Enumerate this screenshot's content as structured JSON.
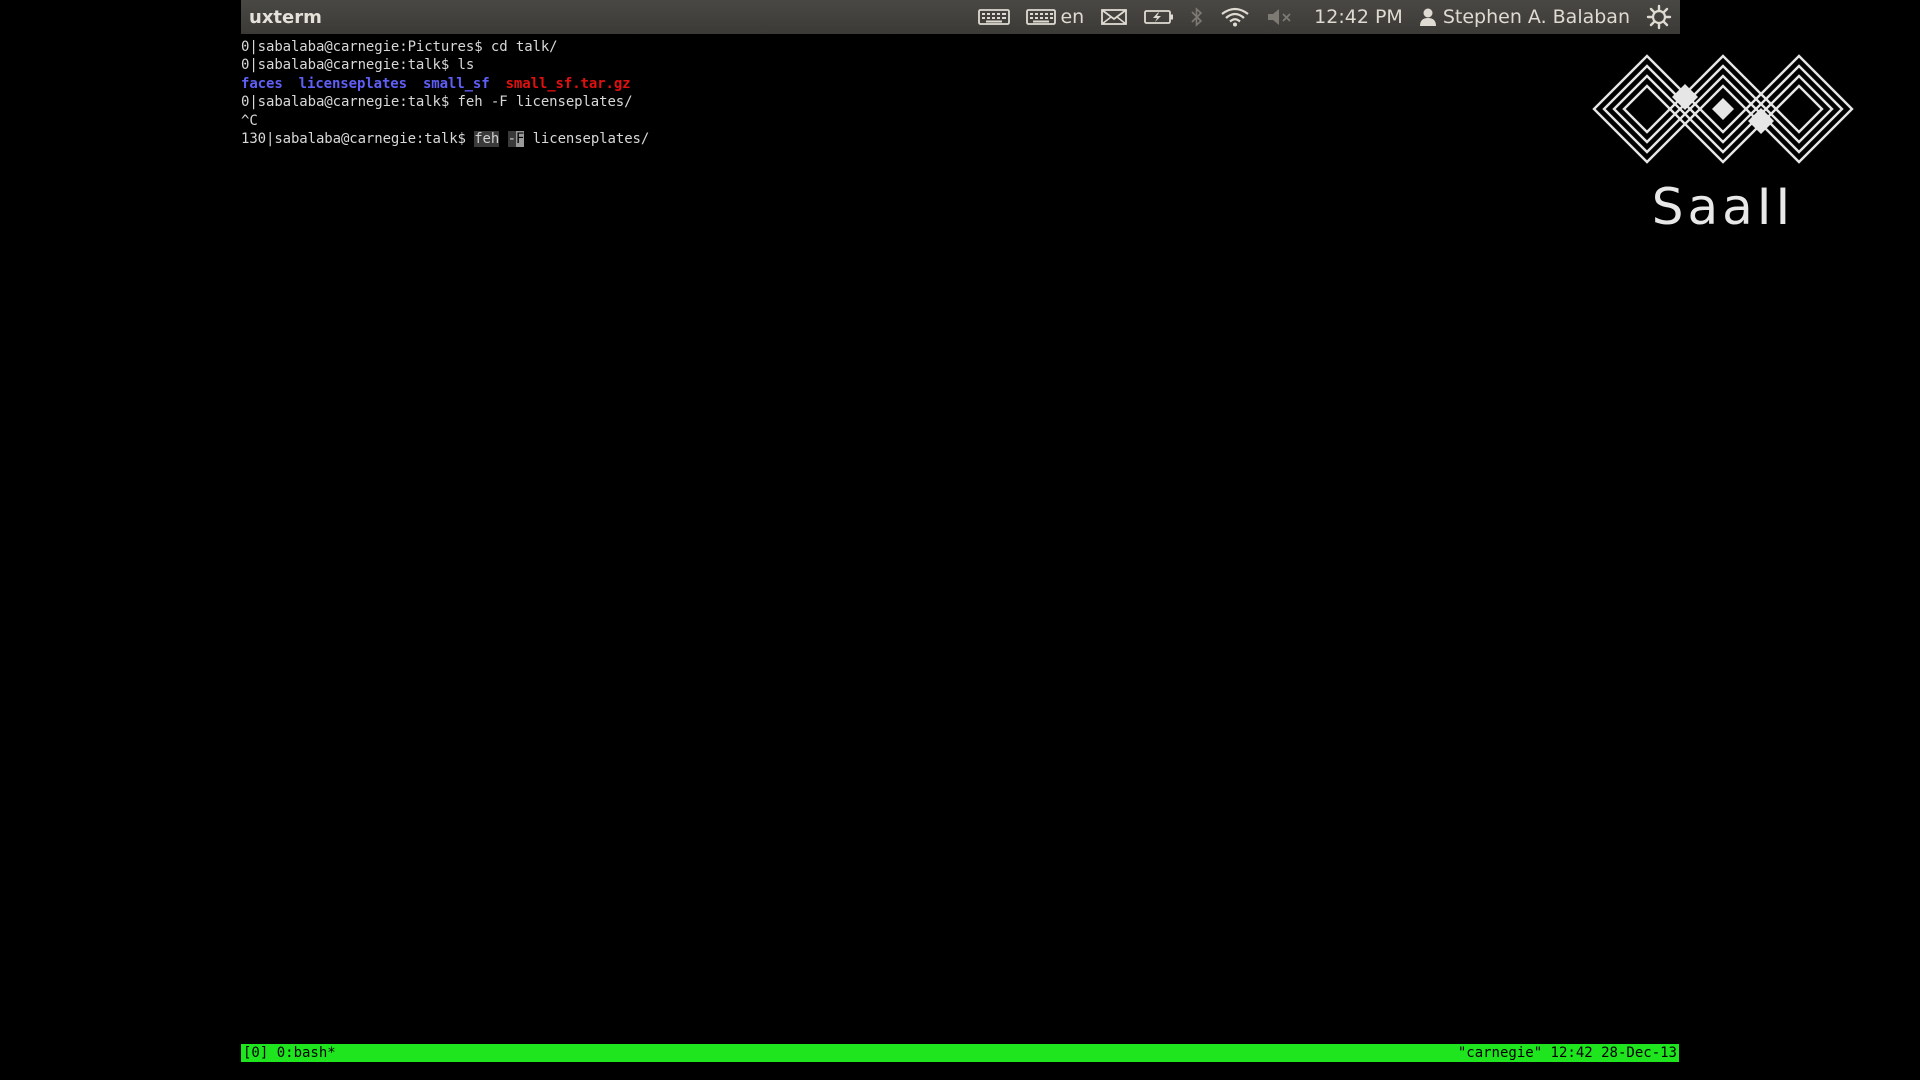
{
  "panel": {
    "window_title": "uxterm",
    "keyboard_layout": "en",
    "clock": "12:42 PM",
    "user_name": "Stephen A. Balaban"
  },
  "terminal": {
    "lines": [
      {
        "prompt": "0|sabalaba@carnegie:Pictures$ ",
        "command": "cd talk/"
      },
      {
        "prompt": "0|sabalaba@carnegie:talk$ ",
        "command": "ls"
      },
      {
        "ls": [
          "faces",
          "licenseplates",
          "small_sf",
          "small_sf.tar.gz"
        ]
      },
      {
        "prompt": "0|sabalaba@carnegie:talk$ ",
        "command": "feh -F licenseplates/"
      },
      {
        "text": "^C"
      },
      {
        "prompt": "130|sabalaba@carnegie:talk$ ",
        "cmd_word": "feh",
        "cmd_flag_prefix": "-",
        "cmd_flag_letter": "F",
        "cmd_rest": " licenseplates/"
      }
    ]
  },
  "tmux": {
    "left": "[0] 0:bash*",
    "right": "\"carnegie\" 12:42 28-Dec-13"
  },
  "watermark": {
    "text": "SaaII"
  },
  "colors": {
    "panel_bg": "#3f3e3a",
    "terminal_bg": "#000000",
    "terminal_fg": "#d8d8d8",
    "directory": "#5f5ff7",
    "archive": "#e01010",
    "tmux_status": "#1ee51e"
  }
}
